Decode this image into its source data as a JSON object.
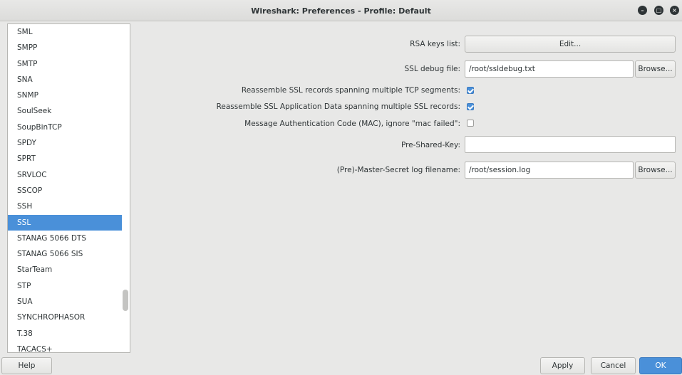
{
  "window": {
    "title": "Wireshark: Preferences - Profile: Default"
  },
  "sidebar": {
    "items": [
      {
        "label": "SML",
        "selected": false
      },
      {
        "label": "SMPP",
        "selected": false
      },
      {
        "label": "SMTP",
        "selected": false
      },
      {
        "label": "SNA",
        "selected": false
      },
      {
        "label": "SNMP",
        "selected": false
      },
      {
        "label": "SoulSeek",
        "selected": false
      },
      {
        "label": "SoupBinTCP",
        "selected": false
      },
      {
        "label": "SPDY",
        "selected": false
      },
      {
        "label": "SPRT",
        "selected": false
      },
      {
        "label": "SRVLOC",
        "selected": false
      },
      {
        "label": "SSCOP",
        "selected": false
      },
      {
        "label": "SSH",
        "selected": false
      },
      {
        "label": "SSL",
        "selected": true
      },
      {
        "label": "STANAG 5066 DTS",
        "selected": false
      },
      {
        "label": "STANAG 5066 SIS",
        "selected": false
      },
      {
        "label": "StarTeam",
        "selected": false
      },
      {
        "label": "STP",
        "selected": false
      },
      {
        "label": "SUA",
        "selected": false
      },
      {
        "label": "SYNCHROPHASOR",
        "selected": false
      },
      {
        "label": "T.38",
        "selected": false
      },
      {
        "label": "TACACS+",
        "selected": false
      }
    ]
  },
  "ssl": {
    "rsa_keys_label": "RSA keys list:",
    "rsa_keys_button": "Edit...",
    "debug_file_label": "SSL debug file:",
    "debug_file_value": "/root/ssldebug.txt",
    "browse_label": "Browse...",
    "reassemble_records_label": "Reassemble SSL records spanning multiple TCP segments:",
    "reassemble_records_checked": true,
    "reassemble_appdata_label": "Reassemble SSL Application Data spanning multiple SSL records:",
    "reassemble_appdata_checked": true,
    "mac_label": "Message Authentication Code (MAC), ignore \"mac failed\":",
    "mac_checked": false,
    "psk_label": "Pre-Shared-Key:",
    "psk_value": "",
    "master_secret_label": "(Pre)-Master-Secret log filename:",
    "master_secret_value": "/root/session.log"
  },
  "footer": {
    "help": "Help",
    "apply": "Apply",
    "cancel": "Cancel",
    "ok": "OK"
  },
  "colors": {
    "accent": "#4a90d9",
    "background": "#e8e8e7"
  }
}
